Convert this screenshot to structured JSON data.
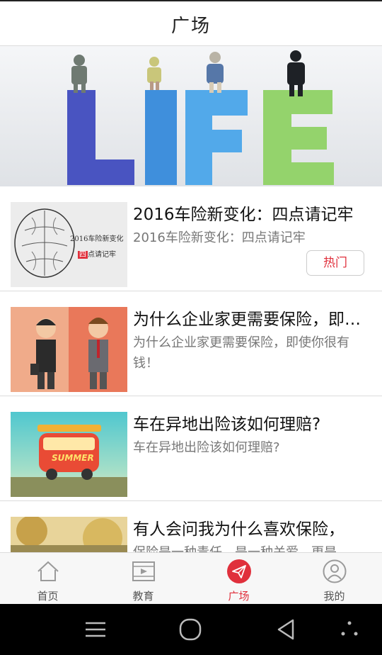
{
  "header": {
    "title": "广场"
  },
  "banner": {
    "word": "LIFE"
  },
  "feed": [
    {
      "title": "2016车险新变化：四点请记牢",
      "desc": "2016车险新变化：四点请记牢",
      "badge": "热门",
      "thumb_text": [
        "2016车险新变化",
        "四",
        "点请记牢"
      ]
    },
    {
      "title": "为什么企业家更需要保险，即使你很有钱！",
      "desc": "为什么企业家更需要保险，即使你很有钱！"
    },
    {
      "title": "车在异地出险该如何理赔?",
      "desc": "车在异地出险该如何理赔?",
      "thumb_text": [
        "SUMMER"
      ]
    },
    {
      "title": "有人会问我为什么喜欢保险，",
      "desc": "保险是一种责任，是一种关爱，更是"
    }
  ],
  "tabs": [
    {
      "label": "首页",
      "icon": "home-icon"
    },
    {
      "label": "教育",
      "icon": "video-icon"
    },
    {
      "label": "广场",
      "icon": "send-icon",
      "active": true
    },
    {
      "label": "我的",
      "icon": "user-icon"
    }
  ],
  "system_nav": [
    "menu-icon",
    "home-circle-icon",
    "back-icon",
    "more-dots-icon"
  ],
  "colors": {
    "accent": "#e0303c",
    "tab_bg": "#f7f7f7",
    "divider": "#dcdcdc"
  }
}
